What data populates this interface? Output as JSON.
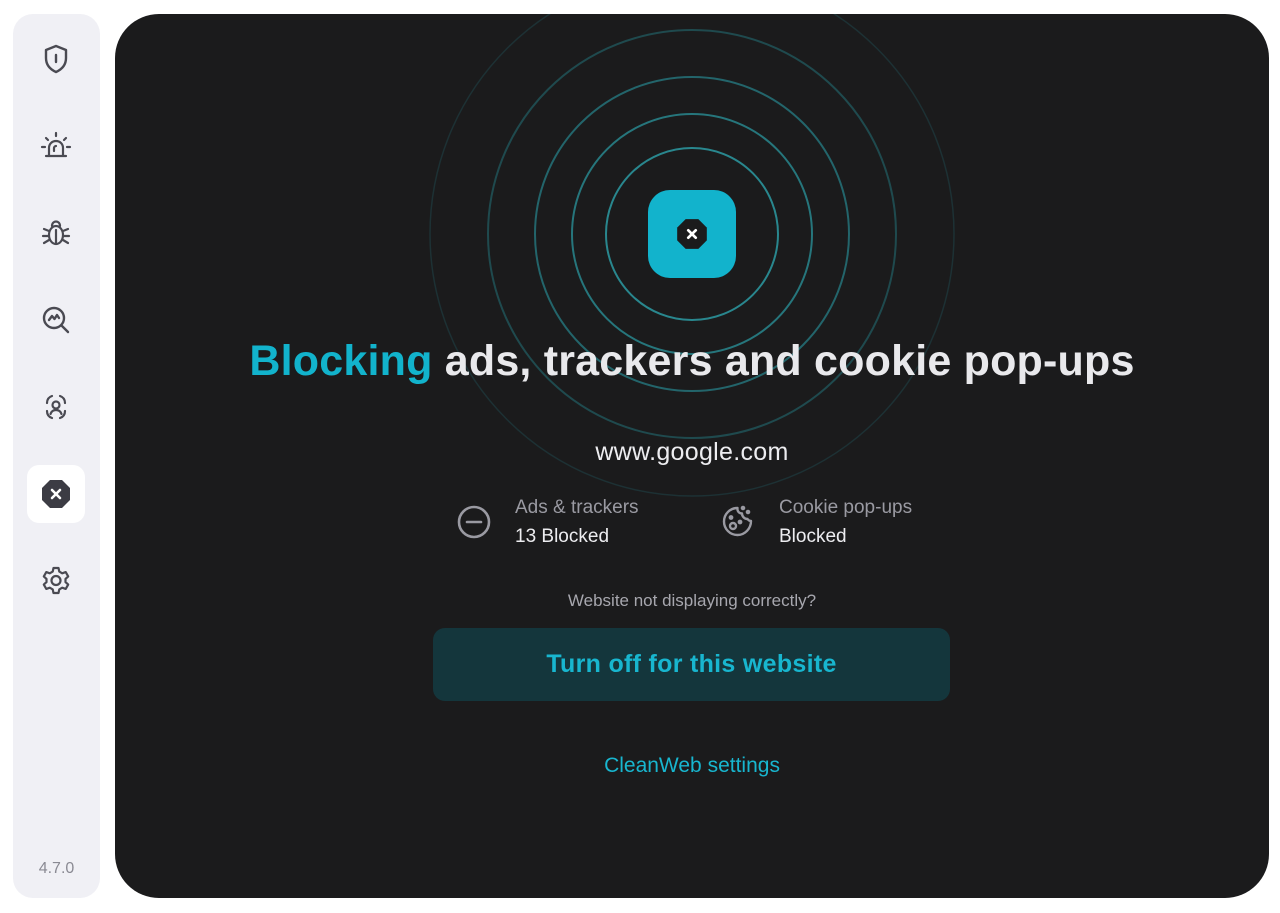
{
  "app": {
    "version": "4.7.0",
    "accent_color": "#12b3cc",
    "panel_color": "#1b1b1c",
    "sidebar_color": "#f0f0f5"
  },
  "sidebar": {
    "items": [
      {
        "icon": "shield-icon",
        "active": false
      },
      {
        "icon": "alarm-light-icon",
        "active": false
      },
      {
        "icon": "bug-icon",
        "active": false
      },
      {
        "icon": "search-scan-icon",
        "active": false
      },
      {
        "icon": "face-scan-icon",
        "active": false
      },
      {
        "icon": "block-octagon-icon",
        "active": true
      },
      {
        "icon": "gear-icon",
        "active": false
      }
    ]
  },
  "main": {
    "badge_icon": "block-octagon-icon",
    "headline_accent": "Blocking",
    "headline_rest": " ads, trackers and cookie pop-ups",
    "site": "www.google.com",
    "stats": [
      {
        "icon": "minus-circle-icon",
        "label": "Ads & trackers",
        "value": "13 Blocked"
      },
      {
        "icon": "cookie-icon",
        "label": "Cookie pop-ups",
        "value": "Blocked"
      }
    ],
    "hint": "Website not displaying correctly?",
    "primary_button": "Turn off for this website",
    "settings_link": "CleanWeb settings"
  }
}
